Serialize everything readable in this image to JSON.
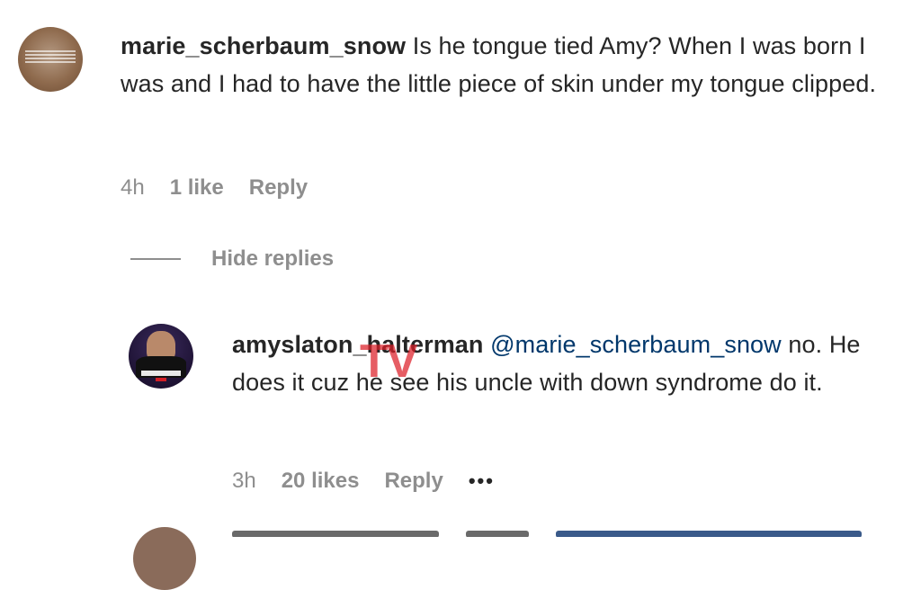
{
  "comments": [
    {
      "username": "marie_scherbaum_snow",
      "text": "Is he tongue tied Amy? When I was born I was and I had to have the little piece of skin under my tongue clipped.",
      "time": "4h",
      "likes": "1 like",
      "reply_label": "Reply"
    }
  ],
  "thread": {
    "hide_replies_label": "Hide replies"
  },
  "replies": [
    {
      "username": "amyslaton_halterman",
      "mention": "@marie_scherbaum_snow",
      "text": "no. He does it cuz he see his uncle with down syndrome do it.",
      "time": "3h",
      "likes": "20 likes",
      "reply_label": "Reply",
      "more_label": "•••"
    }
  ],
  "watermark": "TV",
  "colors": {
    "text": "#262626",
    "meta": "#8e8e8e",
    "mention": "#00376b",
    "watermark": "#dc1e28"
  }
}
